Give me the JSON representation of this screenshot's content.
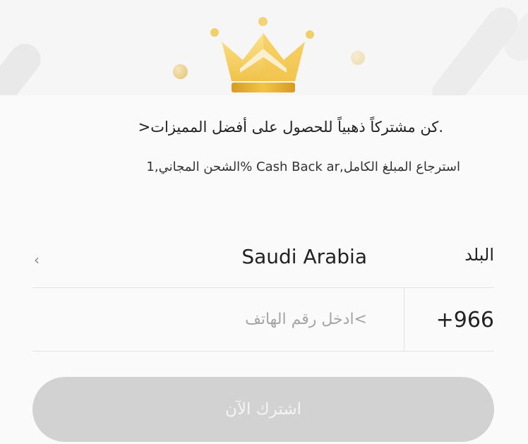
{
  "hero": {
    "icon": "crown-icon",
    "colors": {
      "crown_light": "#f8dc7c",
      "crown_mid": "#f0c24a",
      "crown_dark": "#d39a24"
    }
  },
  "headline": ">كن مشتركاً ذهبياً للحصول على أفضل المميزات.",
  "benefits": "الشحن المجاني,1% Cash Back ar,استرجاع المبلغ الكامل",
  "country_row": {
    "label": "البلد",
    "value": "Saudi Arabia",
    "chevron_icon": "chevron-left-icon"
  },
  "phone_row": {
    "code": "+966",
    "placeholder": ">ادخل رقم الهاتف",
    "value": ""
  },
  "subscribe_button": {
    "label": "اشترك الآن",
    "state": "disabled",
    "color": "#d2d2d2"
  }
}
